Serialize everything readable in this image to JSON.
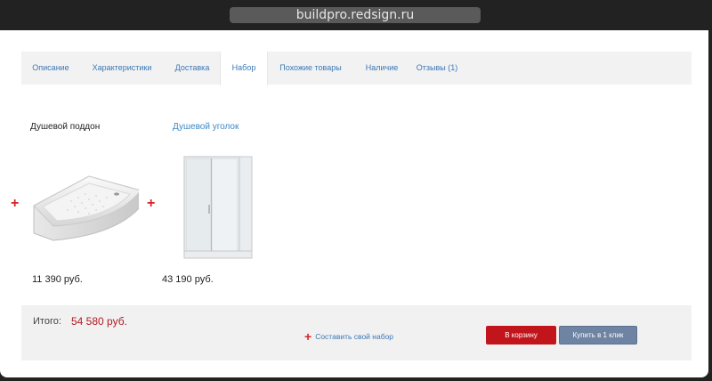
{
  "browser": {
    "url": "buildpro.redsign.ru"
  },
  "tabs": [
    {
      "label": "Описание"
    },
    {
      "label": "Характеристики"
    },
    {
      "label": "Доставка"
    },
    {
      "label": "Набор",
      "active": true
    },
    {
      "label": "Похожие товары"
    },
    {
      "label": "Наличие"
    },
    {
      "label": "Отзывы (1)"
    }
  ],
  "set": {
    "items": [
      {
        "title": "Душевой поддон",
        "price": "11 390 руб.",
        "icon": "shower-tray-image"
      },
      {
        "title": "Душевой уголок",
        "price": "43 190 руб.",
        "icon": "shower-enclosure-image"
      }
    ],
    "plus_symbol": "+"
  },
  "summary": {
    "total_label": "Итого:",
    "total_value": "54 580 руб.",
    "compose_label": "Составить свой набор",
    "cart_button": "В корзину",
    "one_click_button": "Купить в 1 клик"
  },
  "colors": {
    "accent_red": "#c2151b",
    "link_blue": "#3a78b6",
    "button_blue": "#6f84a3"
  }
}
